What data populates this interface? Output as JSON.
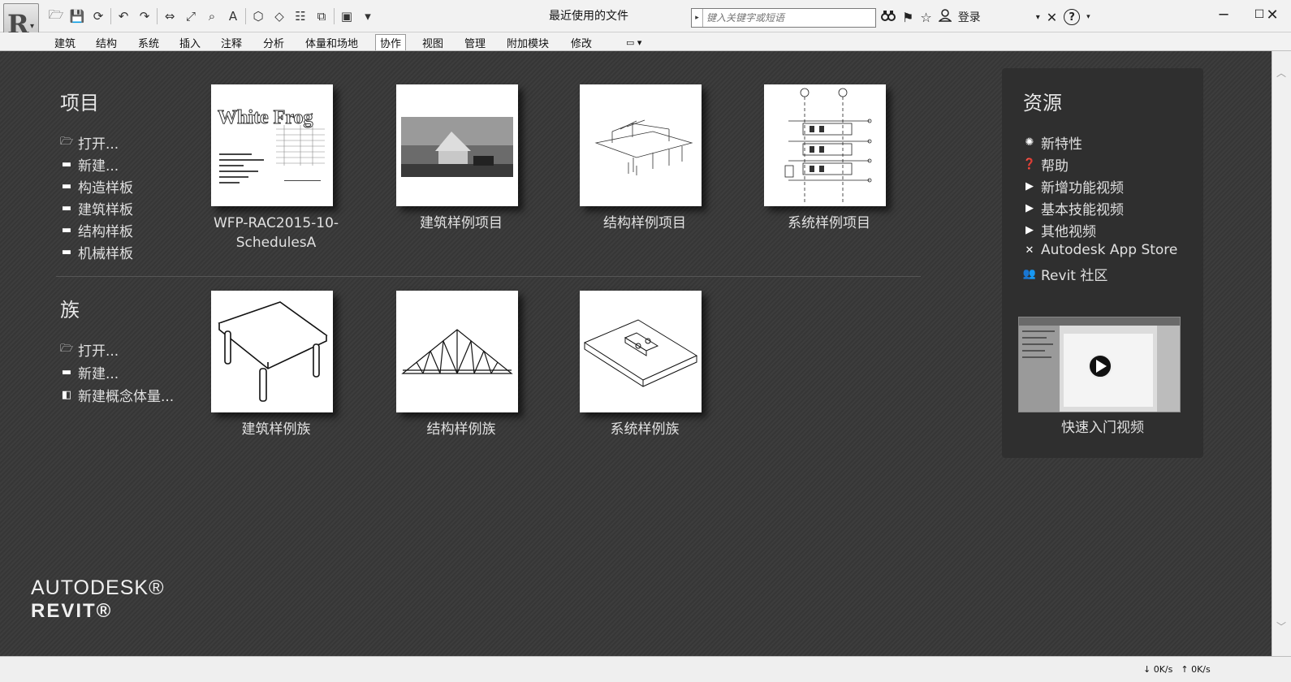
{
  "window": {
    "title": "最近使用的文件",
    "minimize": "─",
    "maximize": "☐",
    "close": "✕"
  },
  "app_button": {
    "letter": "R",
    "caret": "▾"
  },
  "qat": [
    {
      "name": "open-icon",
      "glyph": "🗁"
    },
    {
      "name": "save-icon",
      "glyph": "💾"
    },
    {
      "name": "sync-icon",
      "glyph": "⟳"
    },
    {
      "name": "undo-icon",
      "glyph": "↶"
    },
    {
      "name": "redo-icon",
      "glyph": "↷"
    },
    {
      "name": "measure-icon",
      "glyph": "⇔"
    },
    {
      "name": "dimension-icon",
      "glyph": "⤢"
    },
    {
      "name": "tag-icon",
      "glyph": "⌕"
    },
    {
      "name": "text-icon",
      "glyph": "A"
    },
    {
      "name": "3d-view-icon",
      "glyph": "⬡"
    },
    {
      "name": "section-icon",
      "glyph": "◇"
    },
    {
      "name": "thin-lines-icon",
      "glyph": "☷"
    },
    {
      "name": "close-hidden-icon",
      "glyph": "⧉"
    },
    {
      "name": "switch-windows-icon",
      "glyph": "▣"
    },
    {
      "name": "customize-icon",
      "glyph": "▾"
    }
  ],
  "search": {
    "placeholder": "键入关键字或短语",
    "arrow": "▸"
  },
  "toolbar_right": {
    "binoculars": "🔍",
    "subscription": "⚑",
    "favorites": "☆",
    "user": "👤",
    "login_label": "登录",
    "dropdown": "▾",
    "exchange": "✕",
    "help": "?"
  },
  "ribbon": {
    "tabs": [
      "建筑",
      "结构",
      "系统",
      "插入",
      "注释",
      "分析",
      "体量和场地",
      "协作",
      "视图",
      "管理",
      "附加模块",
      "修改"
    ],
    "active": "协作",
    "extra": "▭ ▾"
  },
  "projects": {
    "title": "项目",
    "links": [
      {
        "label": "打开...",
        "icon": "open-folder-icon",
        "glyph": "🗁"
      },
      {
        "label": "新建...",
        "icon": "new-file-icon",
        "glyph": "▬"
      },
      {
        "label": "构造样板",
        "icon": "template-icon",
        "glyph": "▬"
      },
      {
        "label": "建筑样板",
        "icon": "template-icon",
        "glyph": "▬"
      },
      {
        "label": "结构样板",
        "icon": "template-icon",
        "glyph": "▬"
      },
      {
        "label": "机械样板",
        "icon": "template-icon",
        "glyph": "▬"
      }
    ],
    "recent": [
      {
        "caption": "WFP-RAC2015-10-SchedulesA",
        "thumb_text": "White Frog"
      },
      {
        "caption": "建筑样例项目"
      },
      {
        "caption": "结构样例项目"
      },
      {
        "caption": "系统样例项目"
      }
    ]
  },
  "families": {
    "title": "族",
    "links": [
      {
        "label": "打开...",
        "icon": "open-folder-icon",
        "glyph": "🗁"
      },
      {
        "label": "新建...",
        "icon": "new-file-icon",
        "glyph": "▬"
      },
      {
        "label": "新建概念体量...",
        "icon": "mass-icon",
        "glyph": "◧"
      }
    ],
    "recent": [
      {
        "caption": "建筑样例族"
      },
      {
        "caption": "结构样例族"
      },
      {
        "caption": "系统样例族"
      }
    ]
  },
  "resources": {
    "title": "资源",
    "links": [
      {
        "label": "新特性",
        "icon": "whats-new-icon",
        "glyph": "✺"
      },
      {
        "label": "帮助",
        "icon": "help-icon",
        "glyph": "❓"
      },
      {
        "label": "新增功能视频",
        "icon": "video-icon",
        "glyph": "▶"
      },
      {
        "label": "基本技能视频",
        "icon": "video-icon",
        "glyph": "▶"
      },
      {
        "label": "其他视频",
        "icon": "video-icon",
        "glyph": "▶"
      },
      {
        "label": "Autodesk App Store",
        "icon": "app-store-icon",
        "glyph": "✕"
      },
      {
        "label": "Revit 社区",
        "icon": "community-icon",
        "glyph": "👥"
      }
    ],
    "video_caption": "快速入门视频"
  },
  "brand": {
    "line1": "AUTODESK®",
    "line2": "REVIT®"
  },
  "status": {
    "down": "0K/s",
    "up": "0K/s"
  }
}
